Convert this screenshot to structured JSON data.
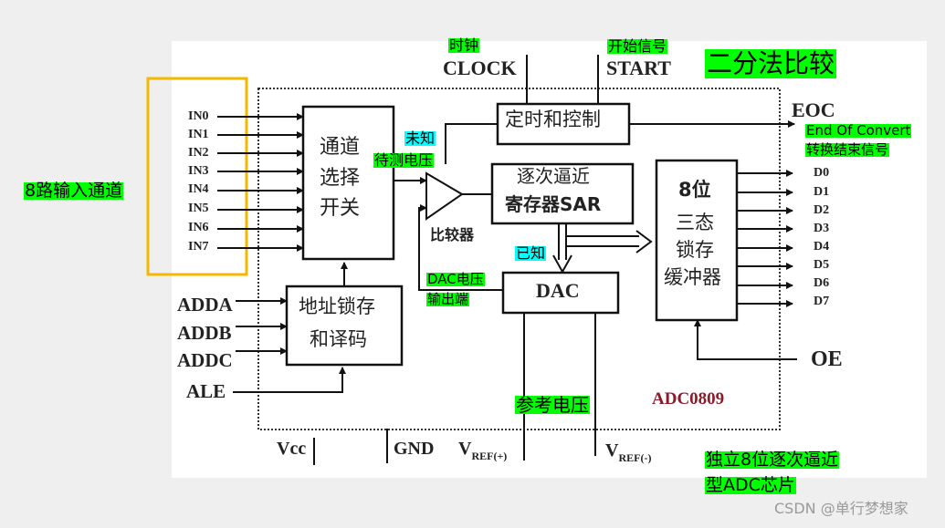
{
  "colors": {
    "background": "#efefef",
    "canvas": "#ffffff",
    "highlight_green": "#00ff00",
    "highlight_cyan": "#00ffff",
    "input_frame": "#f5b800",
    "chip_name": "#8b1a2b",
    "line": "#111111"
  },
  "title_annotation": "二分法比较",
  "left_annotation": "8路输入通道",
  "inputs": [
    "IN0",
    "IN1",
    "IN2",
    "IN3",
    "IN4",
    "IN5",
    "IN6",
    "IN7"
  ],
  "address_pins": [
    "ADDA",
    "ADDB",
    "ADDC",
    "ALE"
  ],
  "outputs": [
    "D0",
    "D1",
    "D2",
    "D3",
    "D4",
    "D5",
    "D6",
    "D7"
  ],
  "signals": {
    "clock": "CLOCK",
    "clock_note": "时钟",
    "start": "START",
    "start_note": "开始信号",
    "eoc": "EOC",
    "eoc_note_en": "End Of Convert",
    "eoc_note_zh": "转换结束信号",
    "oe": "OE",
    "vcc": "Vcc",
    "gnd": "GND",
    "vref_plus_main": "V",
    "vref_plus_sub": "REF(+)",
    "vref_minus_main": "V",
    "vref_minus_sub": "REF(-)"
  },
  "blocks": {
    "mux": [
      "通道",
      "选择",
      "开关"
    ],
    "timing": "定时和控制",
    "sar": [
      "逐次逼近",
      "寄存器SAR"
    ],
    "latch": [
      "8位",
      "三态",
      "锁存",
      "缓冲器"
    ],
    "dac": "DAC",
    "addr_decoder": [
      "地址锁存",
      "和译码"
    ],
    "comparator": "比较器"
  },
  "annotations": {
    "unknown": "未知",
    "measured_voltage": "待测电压",
    "known": "已知",
    "dac_out_1": "DAC电压",
    "dac_out_2": "输出端",
    "reference_voltage": "参考电压",
    "chip_desc_1": "独立8位逐次逼近",
    "chip_desc_2": "型ADC芯片"
  },
  "chip_name": "ADC0809",
  "watermark": "CSDN @单行梦想家"
}
